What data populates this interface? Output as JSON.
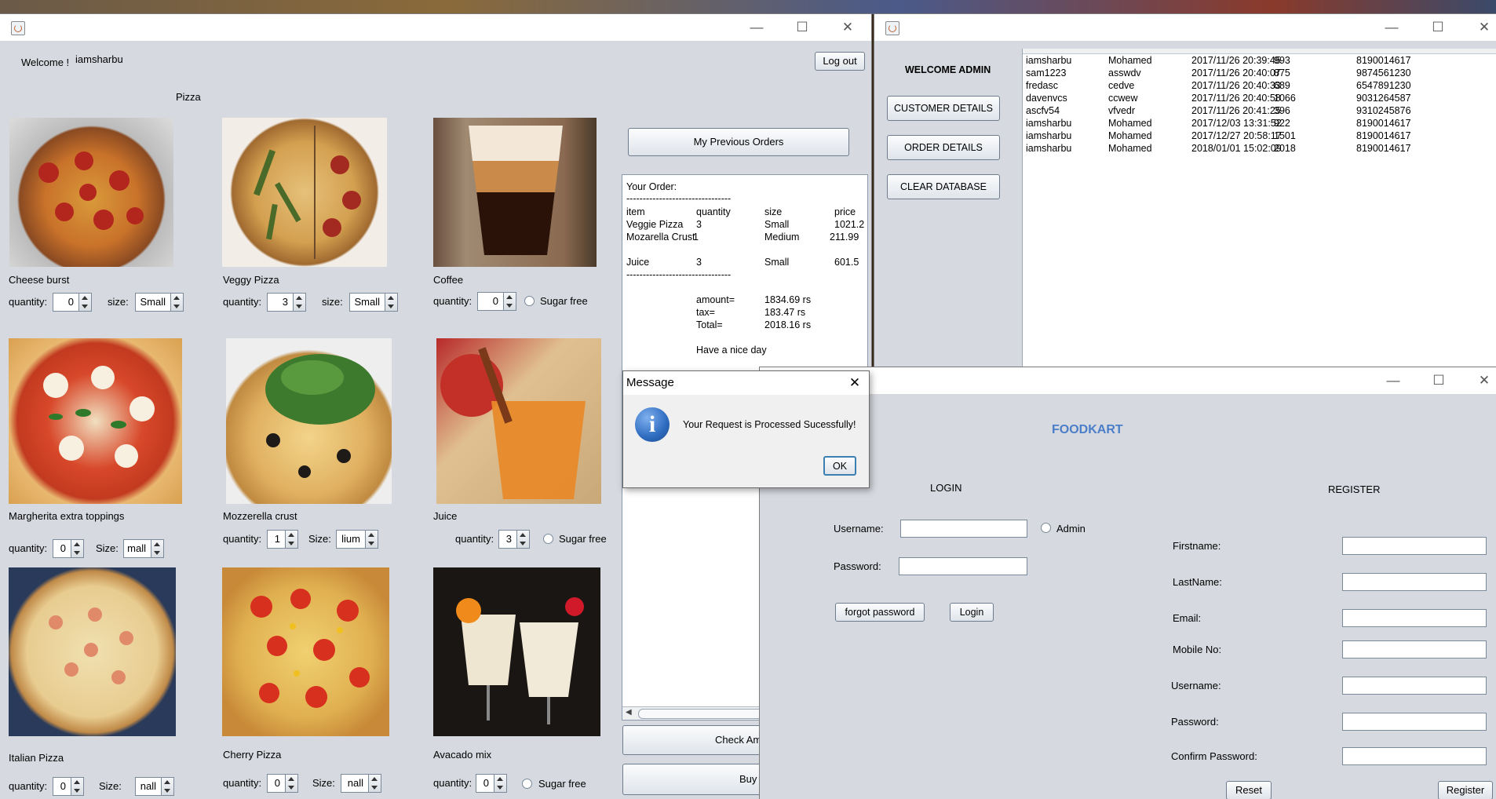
{
  "colors": {
    "window_bg": "#d6d9df",
    "foodkart_accent": "#4b7ec9",
    "info_icon": "#2e6bbf"
  },
  "customer": {
    "welcome_label": "Welcome !",
    "username": "iamsharbu",
    "logout_label": "Log out",
    "section_label": "Pizza",
    "prev_orders_label": "My Previous Orders",
    "check_amount_label": "Check Amo",
    "buy_label": "Buy",
    "qty_label": "quantity:",
    "size_label_lower": "size:",
    "size_label_upper": "Size:",
    "sugar_label": "Sugar free",
    "items": [
      {
        "name": "Cheese burst",
        "qty": "0",
        "size": "Small"
      },
      {
        "name": "Veggy Pizza",
        "qty": "3",
        "size": "Small"
      },
      {
        "name": "Coffee",
        "qty": "0"
      },
      {
        "name": "Margherita extra toppings",
        "qty": "0",
        "size": "mall"
      },
      {
        "name": "Mozzerella crust",
        "qty": "1",
        "size": "lium"
      },
      {
        "name": "Juice",
        "qty": "3"
      },
      {
        "name": "Italian Pizza",
        "qty": "0",
        "size": "nall"
      },
      {
        "name": "Cherry Pizza",
        "qty": "0",
        "size": "nall"
      },
      {
        "name": "Avacado mix",
        "qty": "0"
      }
    ],
    "order": {
      "heading": "Your Order:",
      "divider": "--------------------------------",
      "headers": [
        "item",
        "quantity",
        "size",
        "price"
      ],
      "lines": [
        [
          "Veggie Pizza",
          "3",
          "Small",
          "1021.2"
        ],
        [
          "Mozarella Crust",
          "1",
          "Medium",
          "211.99"
        ],
        [
          "Juice",
          "3",
          "Small",
          "601.5"
        ]
      ],
      "amount_label": "amount=",
      "amount": "1834.69 rs",
      "tax_label": "tax=",
      "tax": "183.47 rs",
      "total_label": "Total=",
      "total": "2018.16 rs",
      "footer": "Have a nice day"
    }
  },
  "admin": {
    "welcome": "WELCOME ADMIN",
    "buttons": [
      "CUSTOMER DETAILS",
      "ORDER DETAILS",
      "CLEAR DATABASE"
    ],
    "rows": [
      [
        "iamsharbu",
        "Mohamed",
        "2017/11/26 20:39:45",
        "993",
        "8190014617"
      ],
      [
        "sam1223",
        "asswdv",
        "2017/11/26 20:40:07",
        "875",
        "9874561230"
      ],
      [
        "fredasc",
        "cedve",
        "2017/11/26 20:40:33",
        "689",
        "6547891230"
      ],
      [
        "davenvcs",
        "ccwew",
        "2017/11/26 20:40:58",
        "1066",
        "9031264587"
      ],
      [
        "ascfv54",
        "vfvedr",
        "2017/11/26 20:41:25",
        "396",
        "9310245876"
      ],
      [
        "iamsharbu",
        "Mohamed",
        "2017/12/03 13:31:52",
        "922",
        "8190014617"
      ],
      [
        "iamsharbu",
        "Mohamed",
        "2017/12/27 20:58:17",
        "1501",
        "8190014617"
      ],
      [
        "iamsharbu",
        "Mohamed",
        "2018/01/01 15:02:09",
        "2018",
        "8190014617"
      ]
    ]
  },
  "dialog": {
    "title": "Message",
    "text": "Your Request is Processed Sucessfully!",
    "ok": "OK",
    "info_glyph": "i"
  },
  "login": {
    "brand": "FOODKART",
    "login_heading": "LOGIN",
    "register_heading": "REGISTER",
    "username_label": "Username:",
    "password_label": "Password:",
    "admin_label": "Admin",
    "forgot_label": "forgot password",
    "login_button": "Login",
    "reg_fields": [
      "Firstname:",
      "LastName:",
      "Email:",
      "Mobile No:",
      "Username:",
      "Password:",
      "Confirm Password:"
    ],
    "reset_label": "Reset",
    "register_label": "Register"
  }
}
